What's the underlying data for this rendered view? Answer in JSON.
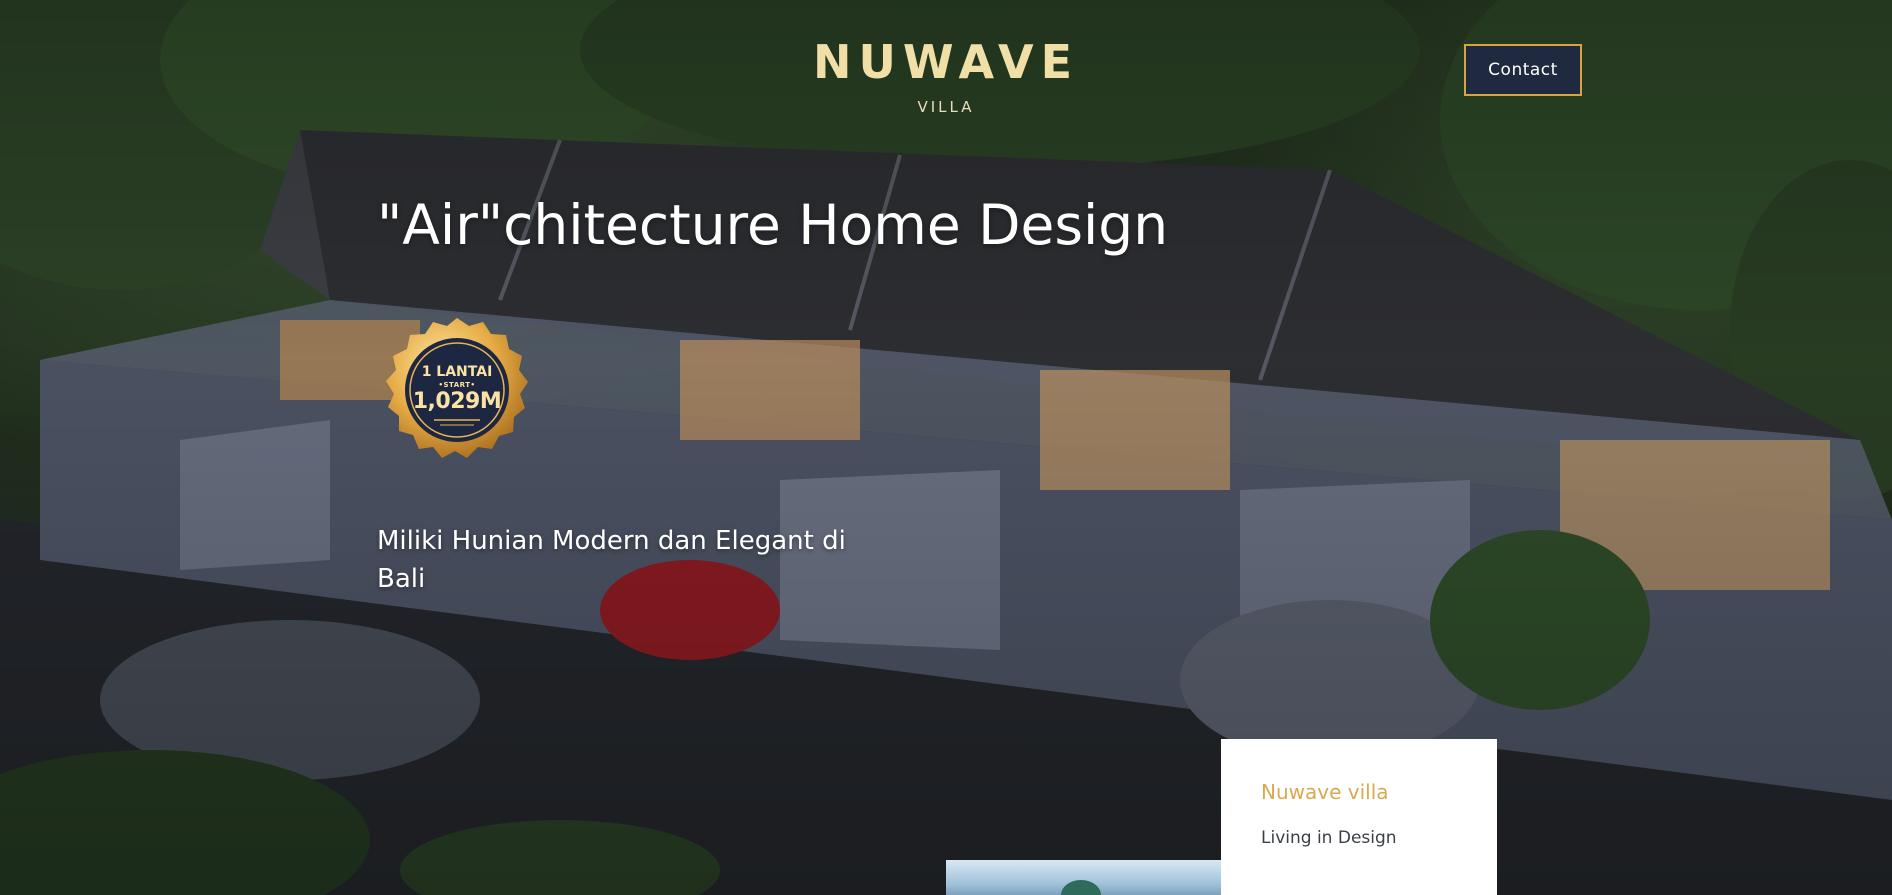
{
  "header": {
    "logo_name": "NUWAVE",
    "logo_sub": "VILLA",
    "contact_label": "Contact"
  },
  "hero": {
    "title": "\"Air\"chitecture Home Design",
    "subtitle": "Miliki Hunian Modern dan Elegant di Bali",
    "badge": {
      "line1": "1 LANTAI",
      "line2": "•START•",
      "line3": "1,029M"
    }
  },
  "card": {
    "title": "Nuwave villa",
    "subtitle": "Living in Design"
  },
  "colors": {
    "accent_gold": "#d9a94d",
    "logo_cream": "#f1dfa8",
    "button_navy": "#1f2a40",
    "button_border": "#d7a443"
  }
}
